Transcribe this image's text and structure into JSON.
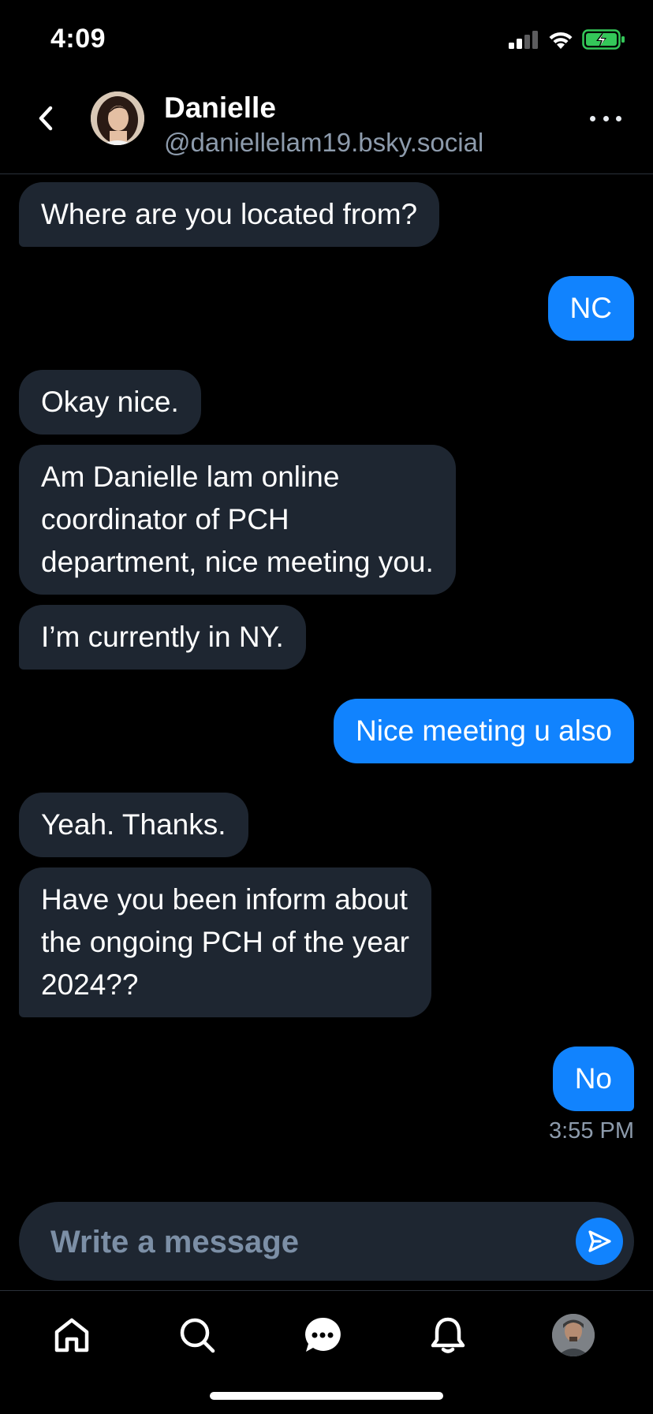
{
  "status_bar": {
    "time": "4:09",
    "signal_icon": "cellular-signal-icon",
    "wifi_icon": "wifi-icon",
    "battery_icon": "battery-charging-icon",
    "battery_color": "#34c759"
  },
  "header": {
    "back_icon": "chevron-left-icon",
    "name": "Danielle",
    "handle": "@daniellelam19.bsky.social",
    "more_icon": "ellipsis-icon"
  },
  "messages": [
    {
      "direction": "in",
      "text": "Where are you located from?"
    },
    {
      "direction": "out",
      "text": "NC"
    },
    {
      "direction": "in",
      "text": "Okay nice."
    },
    {
      "direction": "in",
      "lines": [
        "Am Danielle lam online",
        "coordinator of PCH",
        "department, nice meeting you."
      ]
    },
    {
      "direction": "in",
      "text": "I’m currently in NY."
    },
    {
      "direction": "out",
      "text": "Nice meeting u also"
    },
    {
      "direction": "in",
      "text": "Yeah. Thanks."
    },
    {
      "direction": "in",
      "lines": [
        "Have you been inform about",
        "the ongoing PCH of the year",
        "2024??"
      ]
    },
    {
      "direction": "out",
      "text": "No"
    }
  ],
  "last_timestamp": "3:55 PM",
  "composer": {
    "placeholder": "Write a message",
    "send_icon": "send-icon"
  },
  "tabbar": {
    "items": [
      "home-icon",
      "search-icon",
      "chat-icon",
      "bell-icon",
      "profile-avatar"
    ]
  },
  "colors": {
    "background": "#000000",
    "incoming_bubble": "#1e2631",
    "outgoing_bubble": "#1183fe",
    "secondary_text": "#8d9bac"
  }
}
